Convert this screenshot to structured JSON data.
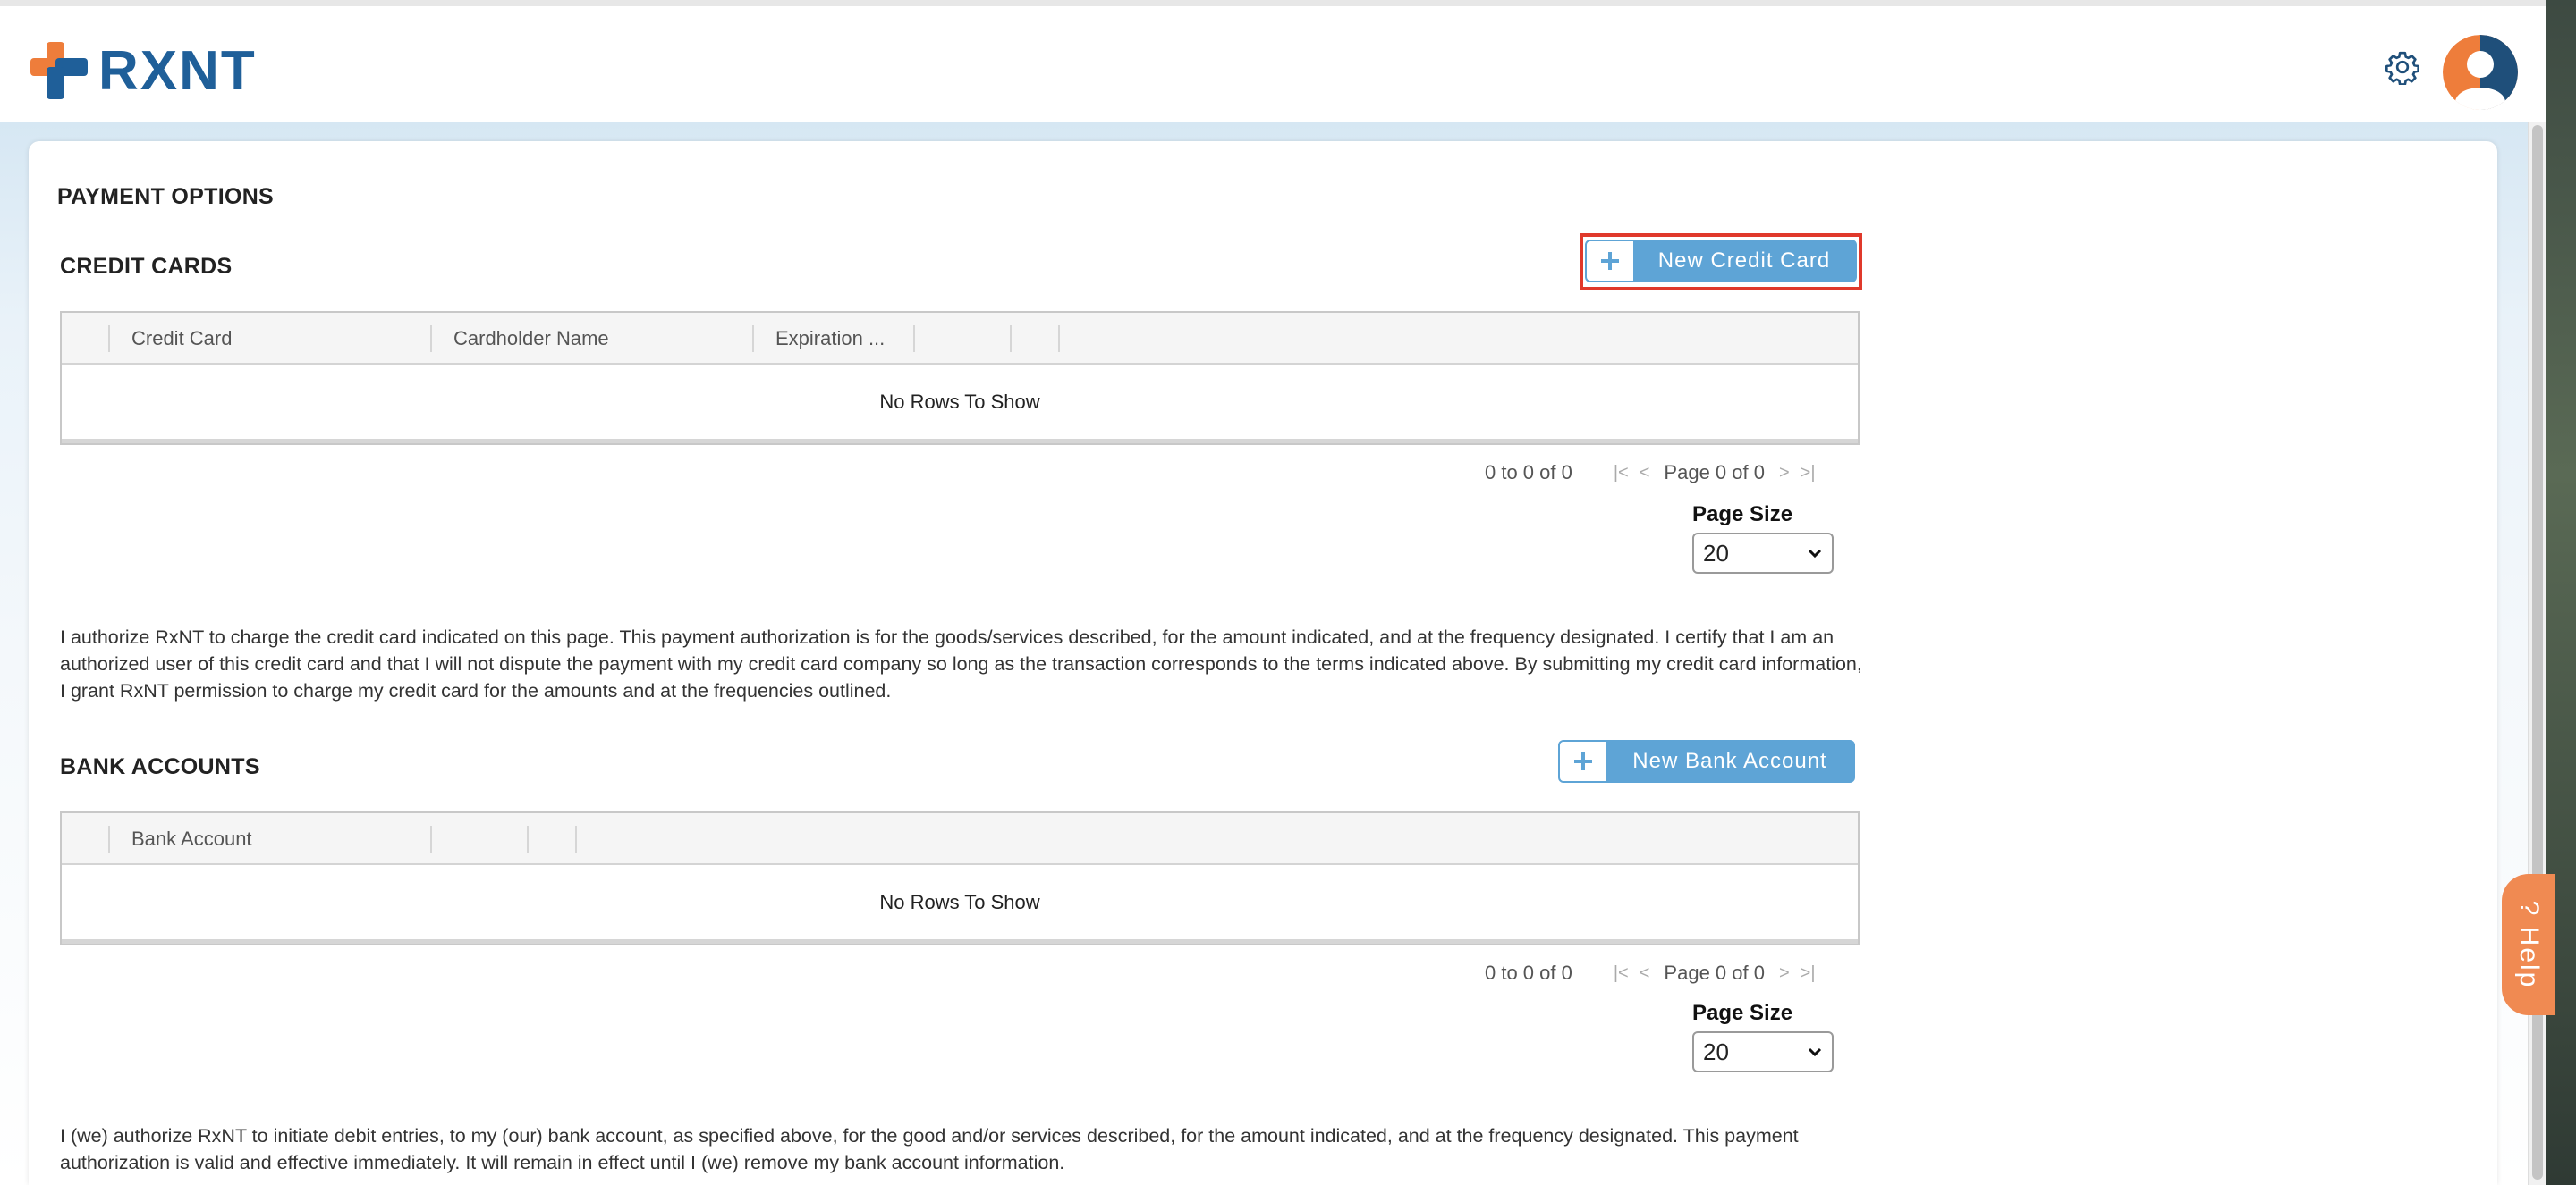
{
  "app": {
    "logo_text": "RXNT",
    "brand_blue": "#1f5f99",
    "brand_orange": "#ee7d3b",
    "accent_button": "#5ea4d6",
    "highlight_color": "#e0392b"
  },
  "header": {
    "settings_icon": "gear-icon",
    "avatar_icon": "user-avatar-icon"
  },
  "page": {
    "title": "PAYMENT OPTIONS"
  },
  "credit_cards": {
    "section_title": "CREDIT CARDS",
    "new_button_label": "New Credit Card",
    "columns": [
      "Credit Card",
      "Cardholder Name",
      "Expiration ..."
    ],
    "empty_message": "No Rows To Show",
    "pager": {
      "summary": "0 to 0 of 0",
      "page_text": "Page 0 of 0"
    },
    "page_size_label": "Page Size",
    "page_size_value": "20",
    "authorization_text": "I authorize RxNT to charge the credit card indicated on this page. This payment authorization is for the goods/services described, for the amount indicated, and at the frequency designated. I certify that I am an authorized user of this credit card and that I will not dispute the payment with my credit card company so long as the transaction corresponds to the terms indicated above. By submitting my credit card information, I grant RxNT permission to charge my credit card for the amounts and at the frequencies outlined."
  },
  "bank_accounts": {
    "section_title": "BANK ACCOUNTS",
    "new_button_label": "New Bank Account",
    "columns": [
      "Bank Account"
    ],
    "empty_message": "No Rows To Show",
    "pager": {
      "summary": "0 to 0 of 0",
      "page_text": "Page 0 of 0"
    },
    "page_size_label": "Page Size",
    "page_size_value": "20",
    "authorization_text": "I (we) authorize RxNT to initiate debit entries, to my (our) bank account, as specified above, for the good and/or services described, for the amount indicated, and at the frequency designated. This payment authorization is valid and effective immediately. It will remain in effect until I (we) remove my bank account information."
  },
  "help": {
    "label": "? Help"
  }
}
